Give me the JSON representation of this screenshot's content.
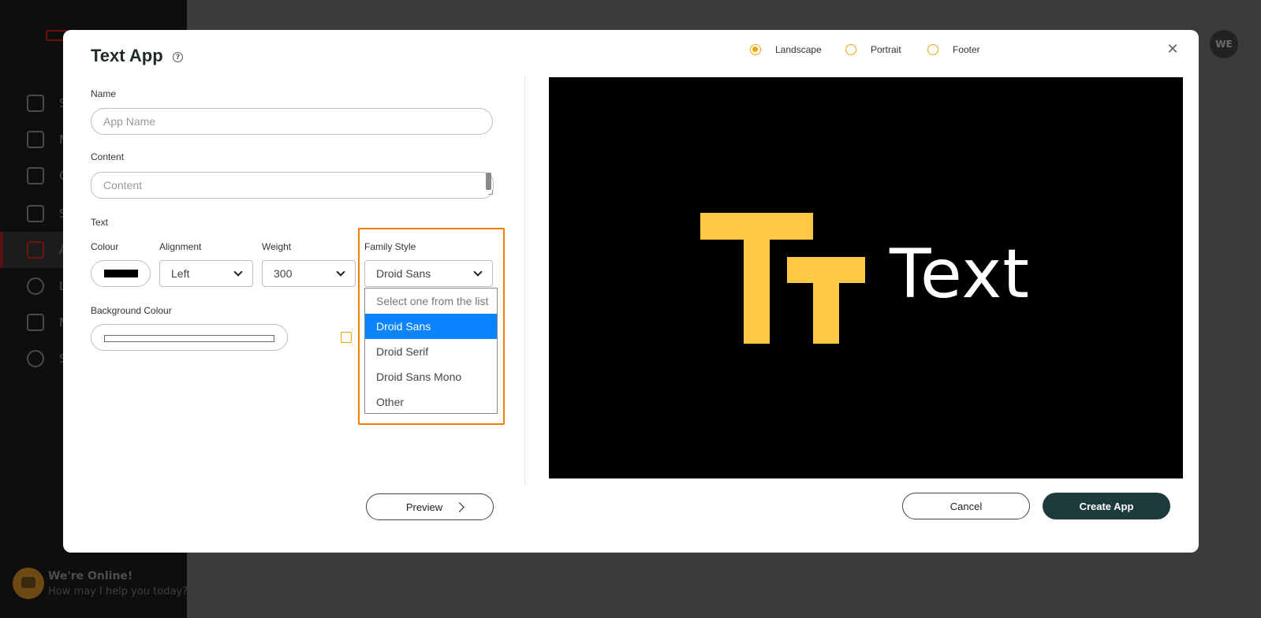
{
  "background": {
    "chat": {
      "title": "We're Online!",
      "subtitle": "How may I help you today?"
    },
    "avatar": "WE",
    "sidebar_letters": [
      "S",
      "M",
      "C",
      "S",
      "A",
      "L",
      "M",
      "S"
    ]
  },
  "modal": {
    "title": "Text App",
    "orientation": {
      "options": [
        {
          "label": "Landscape",
          "checked": true
        },
        {
          "label": "Portrait",
          "checked": false
        },
        {
          "label": "Footer",
          "checked": false
        }
      ]
    },
    "name": {
      "label": "Name",
      "placeholder": "App Name"
    },
    "content": {
      "label": "Content",
      "placeholder": "Content"
    },
    "text_section": {
      "label": "Text",
      "colour": {
        "label": "Colour",
        "value": "#000000"
      },
      "alignment": {
        "label": "Alignment",
        "value": "Left"
      },
      "weight": {
        "label": "Weight",
        "value": "300"
      },
      "family": {
        "label": "Family Style",
        "value": "Droid Sans",
        "options": [
          "Select one from the list",
          "Droid Sans",
          "Droid Serif",
          "Droid Sans Mono",
          "Other"
        ],
        "selected_index": 1
      }
    },
    "background_colour": {
      "label": "Background Colour",
      "value": "#ffffff"
    },
    "preview": {
      "text": "Text",
      "logo_color": "#fdc844"
    },
    "buttons": {
      "preview": "Preview",
      "cancel": "Cancel",
      "create": "Create App"
    }
  },
  "colors": {
    "accent": "#f0a500",
    "highlight": "#f07e00",
    "primary_button": "#1d3b3c",
    "selected_option": "#0a84ff"
  }
}
